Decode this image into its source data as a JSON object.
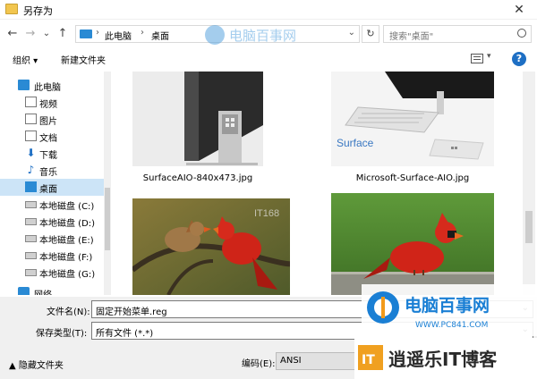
{
  "window": {
    "title": "另存为",
    "close": "✕"
  },
  "nav": {
    "back": "←",
    "forward": "→",
    "recent": "⌄",
    "up": "↑"
  },
  "address": {
    "crumbs": [
      "此电脑",
      "桌面"
    ],
    "sep": "›",
    "dropdown": "⌄",
    "refresh": "↻"
  },
  "search": {
    "placeholder": "搜索\"桌面\""
  },
  "toolbar": {
    "organize": "组织 ▾",
    "new_folder": "新建文件夹",
    "view_dropdown": "▾",
    "help": "?"
  },
  "sidebar": {
    "items": [
      {
        "label": "此电脑",
        "icon": "computer-icon"
      },
      {
        "label": "视频",
        "icon": "video-folder-icon"
      },
      {
        "label": "图片",
        "icon": "pictures-folder-icon"
      },
      {
        "label": "文档",
        "icon": "documents-folder-icon"
      },
      {
        "label": "下载",
        "icon": "download-icon"
      },
      {
        "label": "音乐",
        "icon": "music-icon"
      },
      {
        "label": "桌面",
        "icon": "desktop-icon",
        "selected": true
      },
      {
        "label": "本地磁盘 (C:)",
        "icon": "drive-icon"
      },
      {
        "label": "本地磁盘 (D:)",
        "icon": "drive-icon"
      },
      {
        "label": "本地磁盘 (E:)",
        "icon": "drive-icon"
      },
      {
        "label": "本地磁盘 (F:)",
        "icon": "drive-icon"
      },
      {
        "label": "本地磁盘 (G:)",
        "icon": "drive-icon"
      },
      {
        "label": "网络",
        "icon": "network-icon"
      }
    ]
  },
  "files": [
    {
      "name": "SurfaceAIO-840x473.jpg"
    },
    {
      "name": "Microsoft-Surface-AIO.jpg"
    },
    {
      "name": ""
    },
    {
      "name": ""
    }
  ],
  "thumb_text": {
    "brand": "Surface",
    "tag": "IT168"
  },
  "bottom": {
    "filename_label": "文件名(N):",
    "filename_value": "固定开始菜单.reg",
    "filetype_label": "保存类型(T):",
    "filetype_value": "所有文件 (*.*)",
    "hide_folders": "隐藏文件夹",
    "encoding_label": "编码(E):",
    "encoding_value": "ANSI",
    "dropdown": "⌄"
  },
  "watermarks": {
    "top": "电脑百事网",
    "brand": "电脑百事网",
    "url": "WWW.PC841.COM",
    "logo_it": "IT",
    "site2": "逍遥乐IT博客"
  }
}
